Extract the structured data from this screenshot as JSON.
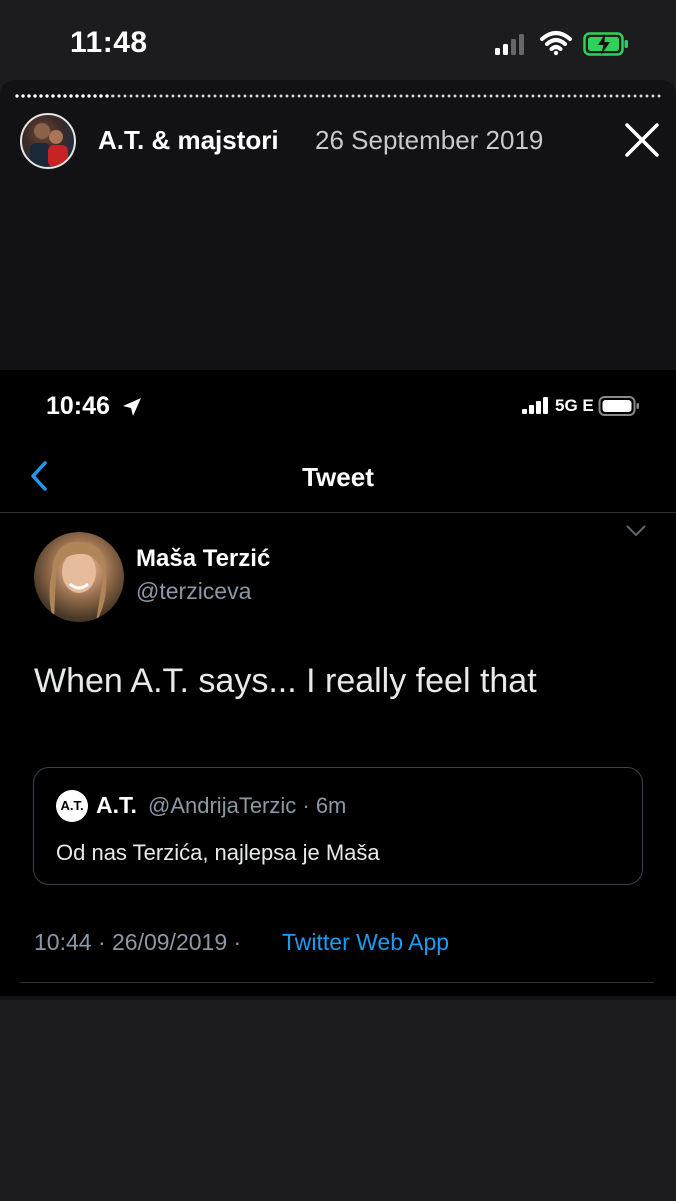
{
  "outer_status": {
    "time": "11:48"
  },
  "story": {
    "author": "A.T. & majstori",
    "date": "26 September 2019"
  },
  "inner_status": {
    "time": "10:46",
    "network": "5G E"
  },
  "header": {
    "title": "Tweet"
  },
  "tweet": {
    "author_name": "Maša Terzić",
    "author_handle": "@terziceva",
    "text": "When A.T. says... I really feel that",
    "quote": {
      "avatar_text": "A.T.",
      "name": "A.T.",
      "meta": "@AndrijaTerzic · 6m",
      "text": "Od nas Terzića, najlepsa je Maša"
    },
    "timestamp": "10:44 · 26/09/2019 · ",
    "source": "Twitter Web App"
  },
  "colors": {
    "link": "#1d9bf0",
    "secondary_text": "#8b98a5",
    "battery_green": "#30d158"
  }
}
